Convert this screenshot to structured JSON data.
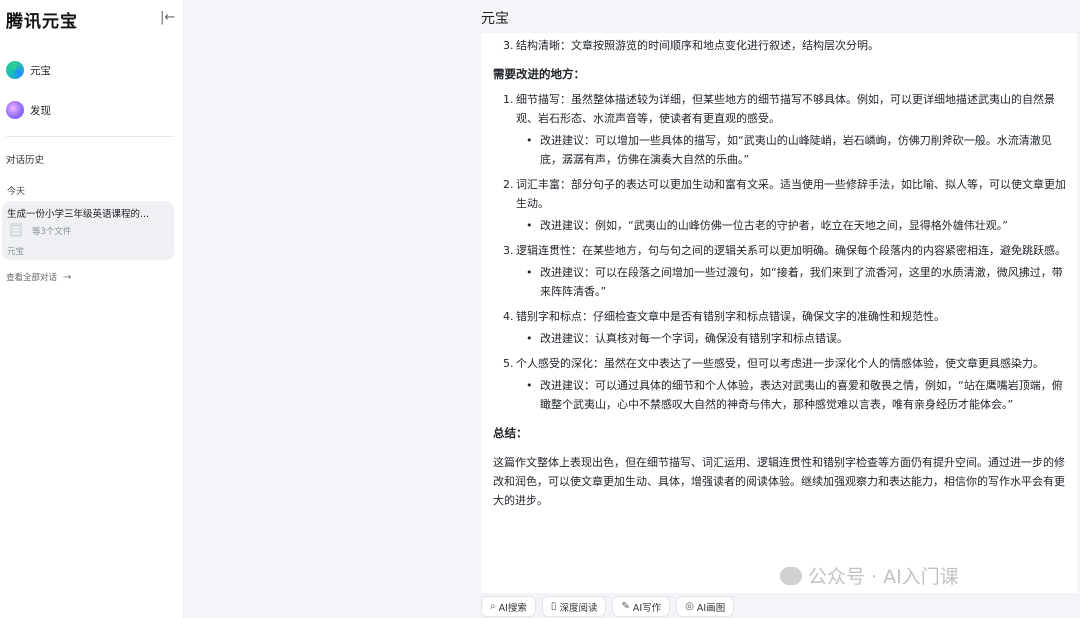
{
  "sidebar": {
    "brand": "腾讯元宝",
    "nav": [
      {
        "label": "元宝",
        "icon": "yuanbao-logo-icon"
      },
      {
        "label": "发现",
        "icon": "discover-icon"
      }
    ],
    "history_title": "对话历史",
    "group_today": "今天",
    "chat": {
      "title": "生成一份小学三年级英语课程的...",
      "files": "等3个文件",
      "source": "元宝"
    },
    "view_all": "查看全部对话"
  },
  "main": {
    "title": "元宝",
    "items": {
      "struct": {
        "num": "3.",
        "text": "结构清晰：文章按照游览的时间顺序和地点变化进行叙述，结构层次分明。"
      },
      "improve_heading": "需要改进的地方：",
      "i1": {
        "num": "1.",
        "text": "细节描写：虽然整体描述较为详细，但某些地方的细节描写不够具体。例如，可以更详细地描述武夷山的自然景观、岩石形态、水流声音等，使读者有更直观的感受。",
        "sub": "改进建议：可以增加一些具体的描写，如“武夷山的山峰陡峭，岩石嶙峋，仿佛刀削斧砍一般。水流清澈见底，潺潺有声，仿佛在演奏大自然的乐曲。”"
      },
      "i2": {
        "num": "2.",
        "text": "词汇丰富：部分句子的表达可以更加生动和富有文采。适当使用一些修辞手法，如比喻、拟人等，可以使文章更加生动。",
        "sub": "改进建议：例如，“武夷山的山峰仿佛一位古老的守护者，屹立在天地之间，显得格外雄伟壮观。”"
      },
      "i3": {
        "num": "3.",
        "text": "逻辑连贯性：在某些地方，句与句之间的逻辑关系可以更加明确。确保每个段落内的内容紧密相连，避免跳跃感。",
        "sub": "改进建议：可以在段落之间增加一些过渡句，如“接着，我们来到了流香河，这里的水质清澈，微风拂过，带来阵阵清香。”"
      },
      "i4": {
        "num": "4.",
        "text": "错别字和标点：仔细检查文章中是否有错别字和标点错误，确保文字的准确性和规范性。",
        "sub": "改进建议：认真核对每一个字词，确保没有错别字和标点错误。"
      },
      "i5": {
        "num": "5.",
        "text": "个人感受的深化：虽然在文中表达了一些感受，但可以考虑进一步深化个人的情感体验，使文章更具感染力。",
        "sub": "改进建议：可以通过具体的细节和个人体验，表达对武夷山的喜爱和敬畏之情，例如，“站在鹰嘴岩顶端，俯瞰整个武夷山，心中不禁感叹大自然的神奇与伟大，那种感觉难以言表，唯有亲身经历才能体会。”"
      },
      "summary_heading": "总结：",
      "summary": "这篇作文整体上表现出色，但在细节描写、词汇运用、逻辑连贯性和错别字检查等方面仍有提升空间。通过进一步的修改和润色，可以使文章更加生动、具体，增强读者的阅读体验。继续加强观察力和表达能力，相信你的写作水平会有更大的进步。"
    }
  },
  "toolbar": [
    {
      "label": "AI搜索",
      "icon": "search-icon"
    },
    {
      "label": "深度阅读",
      "icon": "book-icon"
    },
    {
      "label": "AI写作",
      "icon": "pen-icon"
    },
    {
      "label": "AI画图",
      "icon": "palette-icon"
    }
  ],
  "watermark": "公众号 · AI入门课"
}
